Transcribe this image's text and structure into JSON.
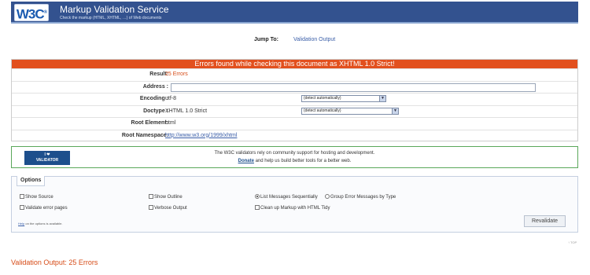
{
  "header": {
    "logo_text": "W3C",
    "logo_mark": "®",
    "title": "Markup Validation Service",
    "subtitle": "Check the markup (HTML, XHTML, …) of Web documents"
  },
  "jump": {
    "label": "Jump To:",
    "link": "Validation Output"
  },
  "results": {
    "banner": "Errors found while checking this document as XHTML 1.0 Strict!",
    "rows": [
      {
        "key": "Result:",
        "value": "25 Errors"
      },
      {
        "key": "Address :",
        "value": ""
      },
      {
        "key": "Encoding :",
        "value": "utf-8",
        "select": "(detect automatically)"
      },
      {
        "key": "Doctype :",
        "value": "XHTML 1.0 Strict",
        "select": "(detect automatically)"
      },
      {
        "key": "Root Element:",
        "value": "html"
      },
      {
        "key": "Root Namespace:",
        "value": "http://www.w3.org/1999/xhtml"
      }
    ]
  },
  "donate": {
    "badge_line1": "I ❤",
    "badge_line2": "VALIDATOR",
    "line1": "The W3C validators rely on community support for hosting and development.",
    "link": "Donate",
    "line2_rest": " and help us build better tools for a better web."
  },
  "options": {
    "title": "Options",
    "show_source": "Show Source",
    "show_outline": "Show Outline",
    "list_sequentially": "List Messages Sequentially",
    "group_by_type": "Group Error Messages by Type",
    "validate_error_pages": "Validate error pages",
    "verbose_output": "Verbose Output",
    "clean_up": "Clean up Markup with HTML Tidy",
    "help_link": "Help",
    "help_rest": " on the options is available.",
    "revalidate": "Revalidate"
  },
  "top_link": "↑ TOP",
  "validation_output": "Validation Output: 25 Errors",
  "colors": {
    "banner": "#33528f",
    "error_bar": "#e2501e",
    "donate_border": "#5aa85a",
    "accent_red": "#d64b17"
  }
}
